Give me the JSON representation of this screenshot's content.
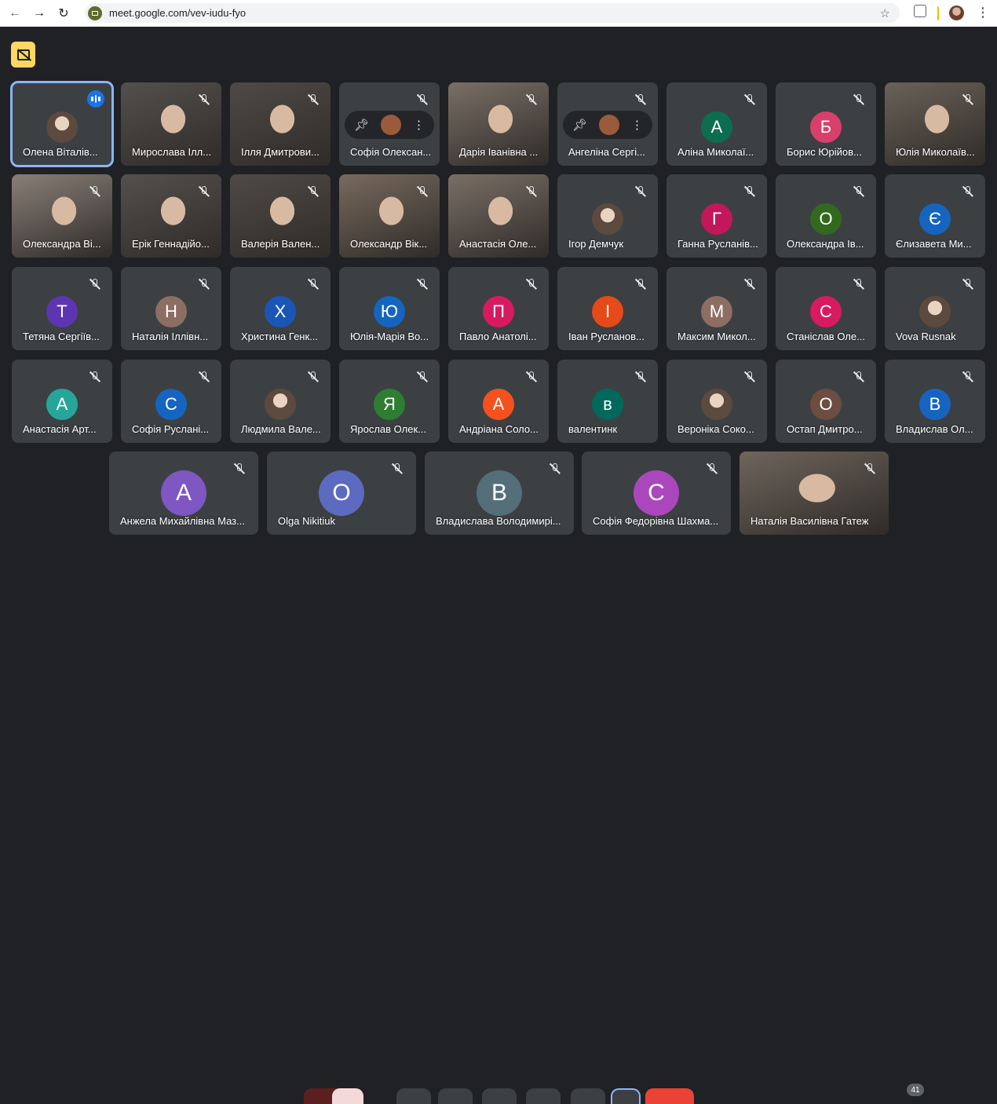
{
  "browser": {
    "url": "meet.google.com/vev-iudu-fyo"
  },
  "colors": {
    "tile": "#3c4043",
    "background": "#202124",
    "accent": "#8ab4f8",
    "host_badge": "#fdd663"
  },
  "participants_row1": [
    {
      "name": "Олена Віталів...",
      "kind": "photo-avatar",
      "speaking": true
    },
    {
      "name": "Мирослава Ілл...",
      "kind": "video"
    },
    {
      "name": "Ілля Дмитрови...",
      "kind": "video"
    },
    {
      "name": "Софія Олексан...",
      "kind": "hover"
    },
    {
      "name": "Дарія Іванівна ...",
      "kind": "video"
    },
    {
      "name": "Ангеліна Сергі...",
      "kind": "hover"
    },
    {
      "name": "Аліна Миколаї...",
      "kind": "letter",
      "letter": "А",
      "color": "#0b6e4f"
    },
    {
      "name": "Борис Юрійов...",
      "kind": "letter",
      "letter": "Б",
      "color": "#d93f6d"
    },
    {
      "name": "Юлія Миколаїв...",
      "kind": "video"
    }
  ],
  "participants_row2": [
    {
      "name": "Олександра Ві...",
      "kind": "video"
    },
    {
      "name": "Ерік Геннадійо...",
      "kind": "video"
    },
    {
      "name": "Валерія Вален...",
      "kind": "video"
    },
    {
      "name": "Олександр Вік...",
      "kind": "video"
    },
    {
      "name": "Анастасія Оле...",
      "kind": "video"
    },
    {
      "name": "Ігор Демчук",
      "kind": "photo-avatar"
    },
    {
      "name": "Ганна Русланів...",
      "kind": "letter",
      "letter": "Г",
      "color": "#c2185b"
    },
    {
      "name": "Олександра Ів...",
      "kind": "letter",
      "letter": "О",
      "color": "#33691e"
    },
    {
      "name": "Єлизавета Ми...",
      "kind": "letter",
      "letter": "Є",
      "color": "#1565c0"
    }
  ],
  "participants_row3": [
    {
      "name": "Тетяна Сергіїв...",
      "kind": "letter",
      "letter": "Т",
      "color": "#5e35b1"
    },
    {
      "name": "Наталія Іллівн...",
      "kind": "letter",
      "letter": "Н",
      "color": "#8d6e63"
    },
    {
      "name": "Христина Генк...",
      "kind": "letter",
      "letter": "Х",
      "color": "#1a56b6"
    },
    {
      "name": "Юлія-Марія Во...",
      "kind": "letter",
      "letter": "Ю",
      "color": "#1565c0"
    },
    {
      "name": "Павло Анатолі...",
      "kind": "letter",
      "letter": "П",
      "color": "#d81b60"
    },
    {
      "name": "Іван Русланов...",
      "kind": "letter",
      "letter": "І",
      "color": "#e64a19"
    },
    {
      "name": "Максим Микол...",
      "kind": "letter",
      "letter": "М",
      "color": "#8d6e63"
    },
    {
      "name": "Станіслав Оле...",
      "kind": "letter",
      "letter": "С",
      "color": "#d81b60"
    },
    {
      "name": "Vova Rusnak",
      "kind": "photo-avatar"
    }
  ],
  "participants_row4": [
    {
      "name": "Анастасія Арт...",
      "kind": "letter",
      "letter": "А",
      "color": "#26a69a"
    },
    {
      "name": "Софія Руслані...",
      "kind": "letter",
      "letter": "С",
      "color": "#1565c0"
    },
    {
      "name": "Людмила Вале...",
      "kind": "photo-avatar"
    },
    {
      "name": "Ярослав Олек...",
      "kind": "letter",
      "letter": "Я",
      "color": "#2e7d32"
    },
    {
      "name": "Андріана Соло...",
      "kind": "letter",
      "letter": "А",
      "color": "#f4511e"
    },
    {
      "name": "валентинк",
      "kind": "letter",
      "letter": "в",
      "color": "#00695c"
    },
    {
      "name": "Вероніка Соко...",
      "kind": "photo-avatar"
    },
    {
      "name": "Остап Дмитро...",
      "kind": "letter",
      "letter": "О",
      "color": "#6d4c41"
    },
    {
      "name": "Владислав Ол...",
      "kind": "letter",
      "letter": "В",
      "color": "#1565c0"
    }
  ],
  "participants_row5": [
    {
      "name": "Анжела Михайлівна Маз...",
      "kind": "letter",
      "letter": "А",
      "color": "#7e57c2"
    },
    {
      "name": "Olga Nikitiuk",
      "kind": "letter",
      "letter": "О",
      "color": "#5c6bc0"
    },
    {
      "name": "Владислава Володимирі...",
      "kind": "letter",
      "letter": "В",
      "color": "#546e7a"
    },
    {
      "name": "Софія Федорівна Шахма...",
      "kind": "letter",
      "letter": "С",
      "color": "#ab47bc"
    },
    {
      "name": "Наталія Василівна Гатеж",
      "kind": "video"
    }
  ],
  "participant_count": "41"
}
